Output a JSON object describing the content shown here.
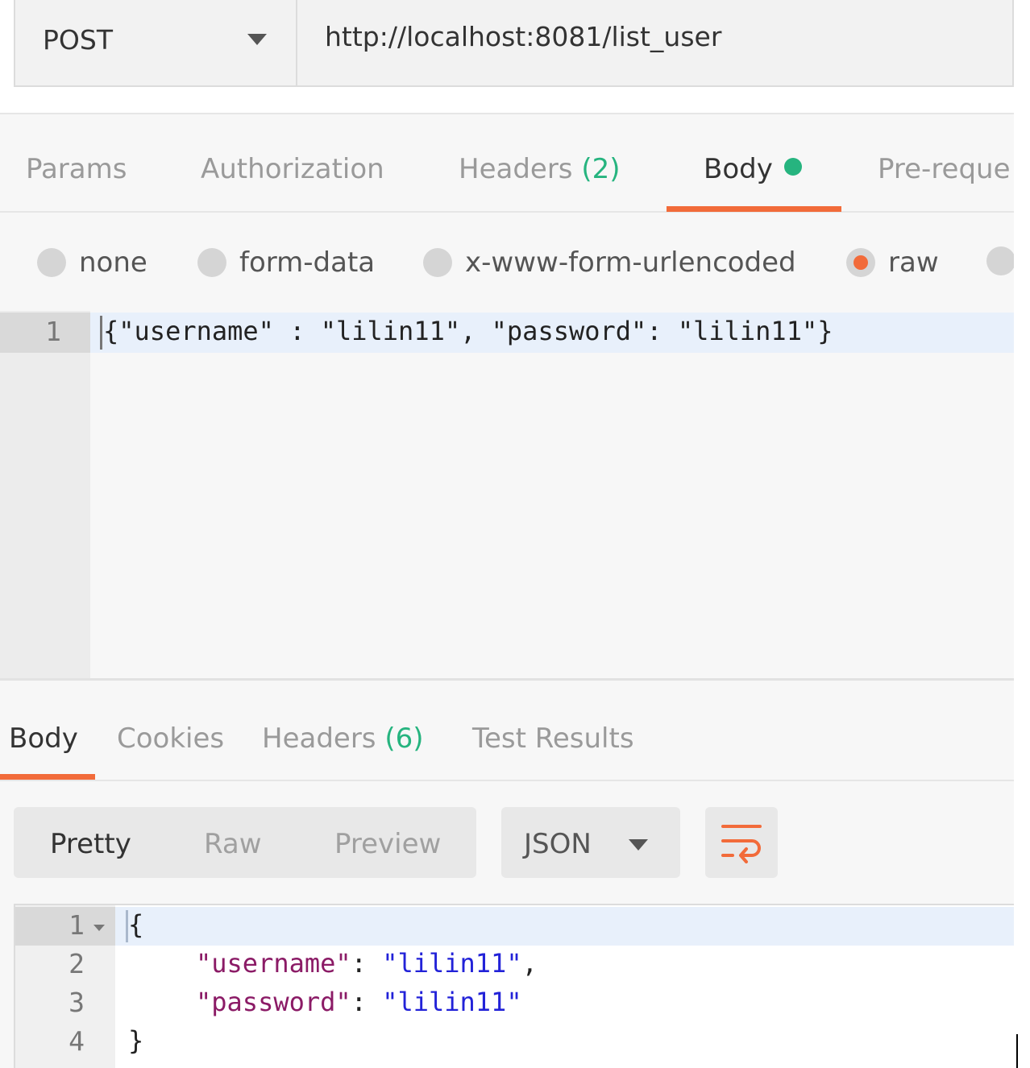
{
  "request": {
    "method": "POST",
    "url": "http://localhost:8081/list_user"
  },
  "request_tabs": [
    {
      "label": "Params"
    },
    {
      "label": "Authorization"
    },
    {
      "label": "Headers",
      "count": "(2)"
    },
    {
      "label": "Body",
      "active": true
    },
    {
      "label": "Pre-reque"
    }
  ],
  "body_modes": [
    {
      "label": "none"
    },
    {
      "label": "form-data"
    },
    {
      "label": "x-www-form-urlencoded"
    },
    {
      "label": "raw",
      "selected": true
    }
  ],
  "request_editor": {
    "line_number": "1",
    "code": "{\"username\" : \"lilin11\", \"password\": \"lilin11\"}"
  },
  "response_tabs": [
    {
      "label": "Body",
      "active": true
    },
    {
      "label": "Cookies"
    },
    {
      "label": "Headers",
      "count": "(6)"
    },
    {
      "label": "Test Results"
    }
  ],
  "response_toolbar": {
    "views": [
      "Pretty",
      "Raw",
      "Preview"
    ],
    "active_view": "Pretty",
    "format": "JSON"
  },
  "response_editor": {
    "line_numbers": [
      "1",
      "2",
      "3",
      "4"
    ],
    "open_brace": "{",
    "close_brace": "}",
    "key_username": "\"username\"",
    "value_username": "\"lilin11\"",
    "key_password": "\"password\"",
    "value_password": "\"lilin11\"",
    "colon": ": ",
    "comma": ","
  },
  "colors": {
    "accent": "#f26b3a",
    "count_green": "#26b47f",
    "json_key": "#8b1b66",
    "json_string": "#2222d8"
  }
}
